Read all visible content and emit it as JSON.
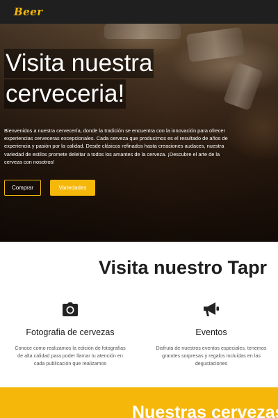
{
  "navbar": {
    "logo_text": "Beer"
  },
  "hero": {
    "title_line_1": "Visita nuestra",
    "title_line_2": "cerveceria!",
    "description": "Bienvenidos a nuestra cervecería, donde la tradición se encuentra con la innovación para ofrecer experiencias cerveceras excepcionales. Cada cerveza que producimos es el resultado de años de experiencia y pasión por la calidad. Desde clásicos refinados hasta creaciones audaces, nuestra variedad de estilos promete deleitar a todos los amantes de la cerveza. ¡Descubre el arte de la cerveza con nosotros!",
    "buy_label": "Comprar",
    "varieties_label": "Variedades"
  },
  "taproom": {
    "title": "Visita nuestro Tapr",
    "features": [
      {
        "icon": "camera-icon",
        "title": "Fotografia de cervezas",
        "text": "Conoce como realizamos la edición de fotografías de alta calidad para poder llamar tu atención en cada publicación que realizamos"
      },
      {
        "icon": "megaphone-icon",
        "title": "Eventos",
        "text": "Disfruta de nuestros eventos especiales, tenemos grandes sorpresas y regalos incluidas en las degustaciones"
      }
    ]
  },
  "beers_section": {
    "title": "Nuestras cervezas"
  },
  "colors": {
    "accent": "#f5b70a",
    "navbar": "#1f1f1f",
    "text_dark": "#1d1d1d"
  }
}
